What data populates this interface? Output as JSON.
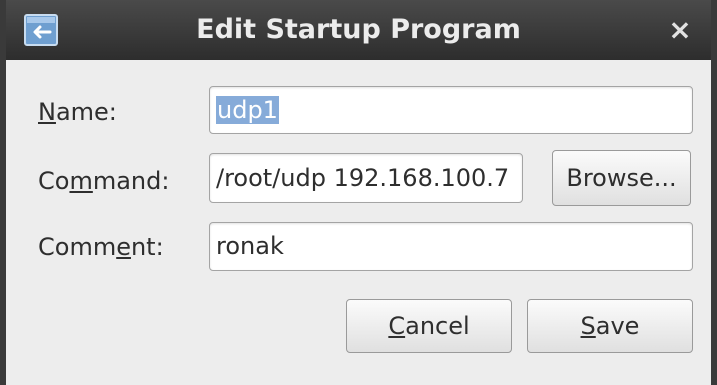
{
  "window": {
    "title": "Edit Startup Program",
    "close_glyph": "×",
    "icon": "startup-app-icon"
  },
  "form": {
    "name": {
      "label_before": "",
      "label_mnemonic": "N",
      "label_after": "ame:",
      "value": "udp1"
    },
    "command": {
      "label_before": "Co",
      "label_mnemonic": "m",
      "label_after": "mand:",
      "value": "/root/udp 192.168.100.7"
    },
    "comment": {
      "label_before": "Comm",
      "label_mnemonic": "e",
      "label_after": "nt:",
      "value": "ronak"
    }
  },
  "buttons": {
    "browse": {
      "label": "Browse..."
    },
    "cancel": {
      "before": "",
      "mnemonic": "C",
      "after": "ancel"
    },
    "save": {
      "before": "",
      "mnemonic": "S",
      "after": "ave"
    }
  },
  "colors": {
    "titlebar": "#2d2d2d",
    "dialog_bg": "#ededed",
    "selection": "#86abd9"
  }
}
